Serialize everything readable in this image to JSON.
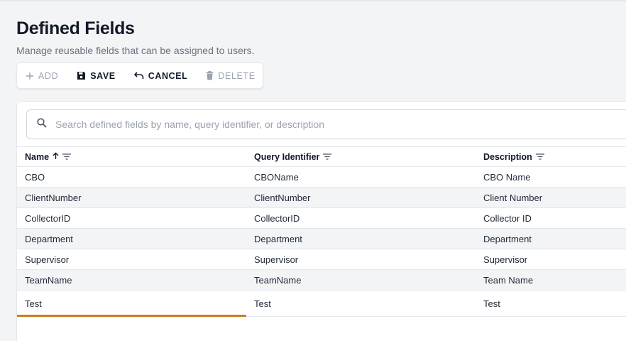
{
  "header": {
    "title": "Defined Fields",
    "subtitle": "Manage reusable fields that can be assigned to users."
  },
  "toolbar": {
    "add_label": "ADD",
    "save_label": "SAVE",
    "cancel_label": "CANCEL",
    "delete_label": "DELETE"
  },
  "search": {
    "placeholder": "Search defined fields by name, query identifier, or description"
  },
  "grid": {
    "columns": [
      "Name",
      "Query Identifier",
      "Description"
    ],
    "rows": [
      {
        "name": "CBO",
        "query": "CBOName",
        "description": "CBO Name"
      },
      {
        "name": "ClientNumber",
        "query": "ClientNumber",
        "description": "Client Number"
      },
      {
        "name": "CollectorID",
        "query": "CollectorID",
        "description": "Collector ID"
      },
      {
        "name": "Department",
        "query": "Department",
        "description": "Department"
      },
      {
        "name": "Supervisor",
        "query": "Supervisor",
        "description": "Supervisor"
      },
      {
        "name": "TeamName",
        "query": "TeamName",
        "description": "Team Name"
      },
      {
        "name": "Test",
        "query": "Test",
        "description": "Test"
      }
    ]
  },
  "colors": {
    "accent": "#c8801f",
    "row_alt": "#f3f4f6",
    "disabled": "#9ca3af"
  }
}
